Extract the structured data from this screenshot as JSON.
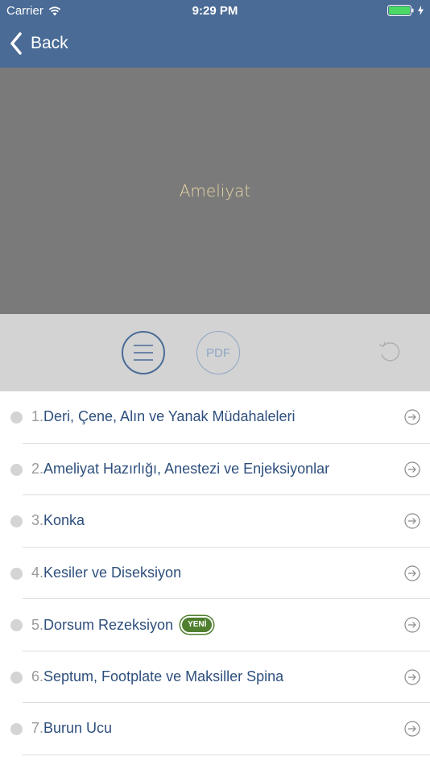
{
  "status_bar": {
    "carrier": "Carrier",
    "time": "9:29 PM",
    "wifi_icon": "wifi-icon",
    "battery_icon": "battery-icon",
    "battery_color": "#4cd964"
  },
  "nav": {
    "back_label": "Back",
    "back_icon": "chevron-left-icon",
    "bar_color": "#4a6b96"
  },
  "hero": {
    "title": "Ameliyat"
  },
  "toolbar": {
    "list_icon": "menu-icon",
    "pdf_label": "PDF",
    "reset_icon": "reset-icon"
  },
  "items": [
    {
      "number": "1.",
      "title": "Deri, Çene, Alın ve Yanak Müdahaleleri",
      "badge": ""
    },
    {
      "number": "2.",
      "title": "Ameliyat Hazırlığı, Anestezi ve Enjeksiyonlar",
      "badge": ""
    },
    {
      "number": "3.",
      "title": "Konka",
      "badge": ""
    },
    {
      "number": "4.",
      "title": "Kesiler ve Diseksiyon",
      "badge": ""
    },
    {
      "number": "5.",
      "title": "Dorsum Rezeksiyon",
      "badge": "YENİ"
    },
    {
      "number": "6.",
      "title": "Septum, Footplate ve Maksiller Spina",
      "badge": ""
    },
    {
      "number": "7.",
      "title": "Burun Ucu",
      "badge": ""
    }
  ]
}
